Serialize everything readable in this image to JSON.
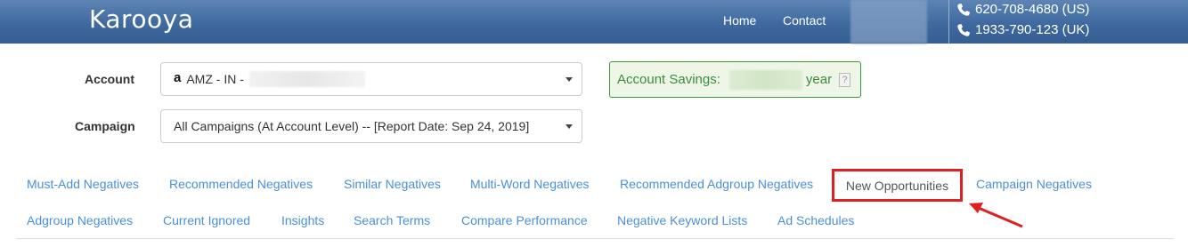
{
  "header": {
    "brand": "Karooya",
    "nav": {
      "home": "Home",
      "contact": "Contact"
    },
    "phones": {
      "us": "620-708-4680 (US)",
      "uk": "1933-790-123 (UK)"
    },
    "colors": {
      "bar": "#3f6a9f",
      "text": "#ffffff"
    }
  },
  "form": {
    "account_label": "Account",
    "account_value": "AMZ - IN -",
    "campaign_label": "Campaign",
    "campaign_value": "All Campaigns (At Account Level) -- [Report Date: Sep 24, 2019]"
  },
  "savings": {
    "label": "Account Savings:",
    "suffix": "year",
    "help": "?"
  },
  "tabs": {
    "row1": [
      "Must-Add Negatives",
      "Recommended Negatives",
      "Similar Negatives",
      "Multi-Word Negatives",
      "Recommended Adgroup Negatives",
      "New Opportunities",
      "Campaign Negatives"
    ],
    "row2": [
      "Adgroup Negatives",
      "Current Ignored",
      "Insights",
      "Search Terms",
      "Compare Performance",
      "Negative Keyword Lists",
      "Ad Schedules"
    ],
    "active": "New Opportunities",
    "colors": {
      "link": "#4a90d9",
      "highlight": "#e02020"
    }
  },
  "icons": {
    "phone": "phone-icon",
    "amazon": "amazon-icon",
    "caret": "chevron-down-icon",
    "help": "help-icon",
    "arrow": "annotation-arrow"
  }
}
